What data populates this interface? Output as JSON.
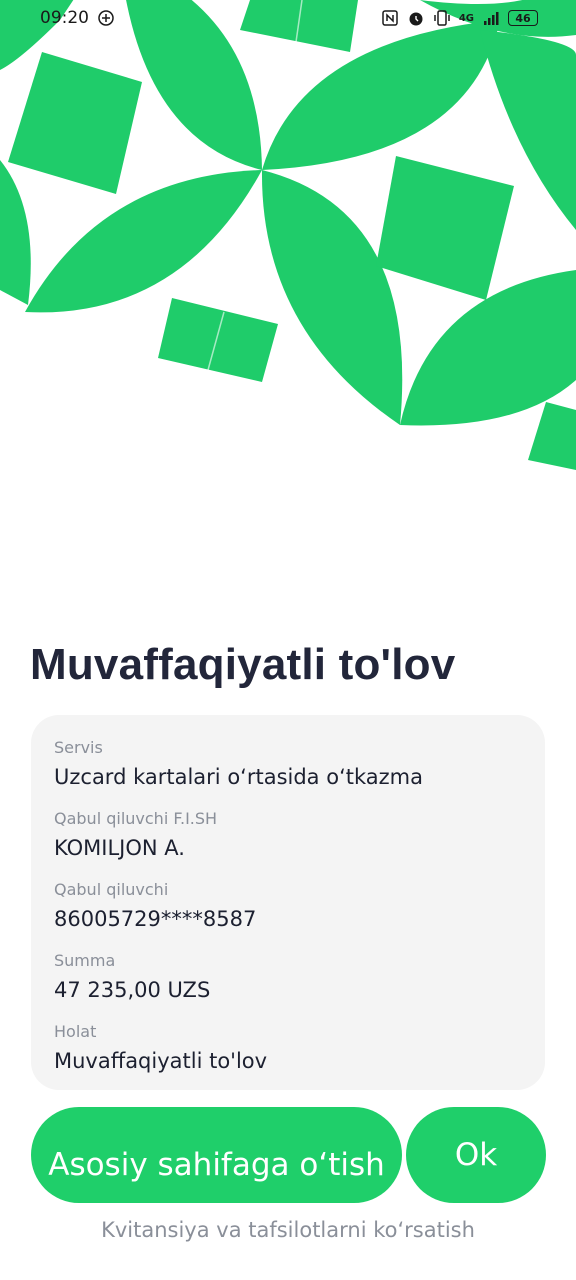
{
  "status_bar": {
    "time": "09:20",
    "network": "4G",
    "battery": "46"
  },
  "colors": {
    "accent": "#1fcf6a",
    "pattern": "#1fcc6a",
    "card_bg": "#f4f4f4",
    "title": "#22263a",
    "muted": "#8a8f99"
  },
  "title": "Muvaffaqiyatli to'lov",
  "details": [
    {
      "label": "Servis",
      "value": "Uzcard kartalari o‘rtasida o‘tkazma"
    },
    {
      "label": "Qabul qiluvchi F.I.SH",
      "value": "KOMILJON A."
    },
    {
      "label": "Qabul qiluvchi",
      "value": "86005729****8587"
    },
    {
      "label": "Summa",
      "value": "47 235,00 UZS"
    },
    {
      "label": "Holat",
      "value": "Muvaffaqiyatli to'lov"
    }
  ],
  "buttons": {
    "home_label": "Asosiy sahifaga o‘tish",
    "ok_label": "Ok"
  },
  "receipt_link": "Kvitansiya va tafsilotlarni ko‘rsatish",
  "icons": [
    "location-icon",
    "nfc-icon",
    "alarm-icon",
    "vibrate-icon",
    "signal-icon",
    "battery-icon"
  ]
}
